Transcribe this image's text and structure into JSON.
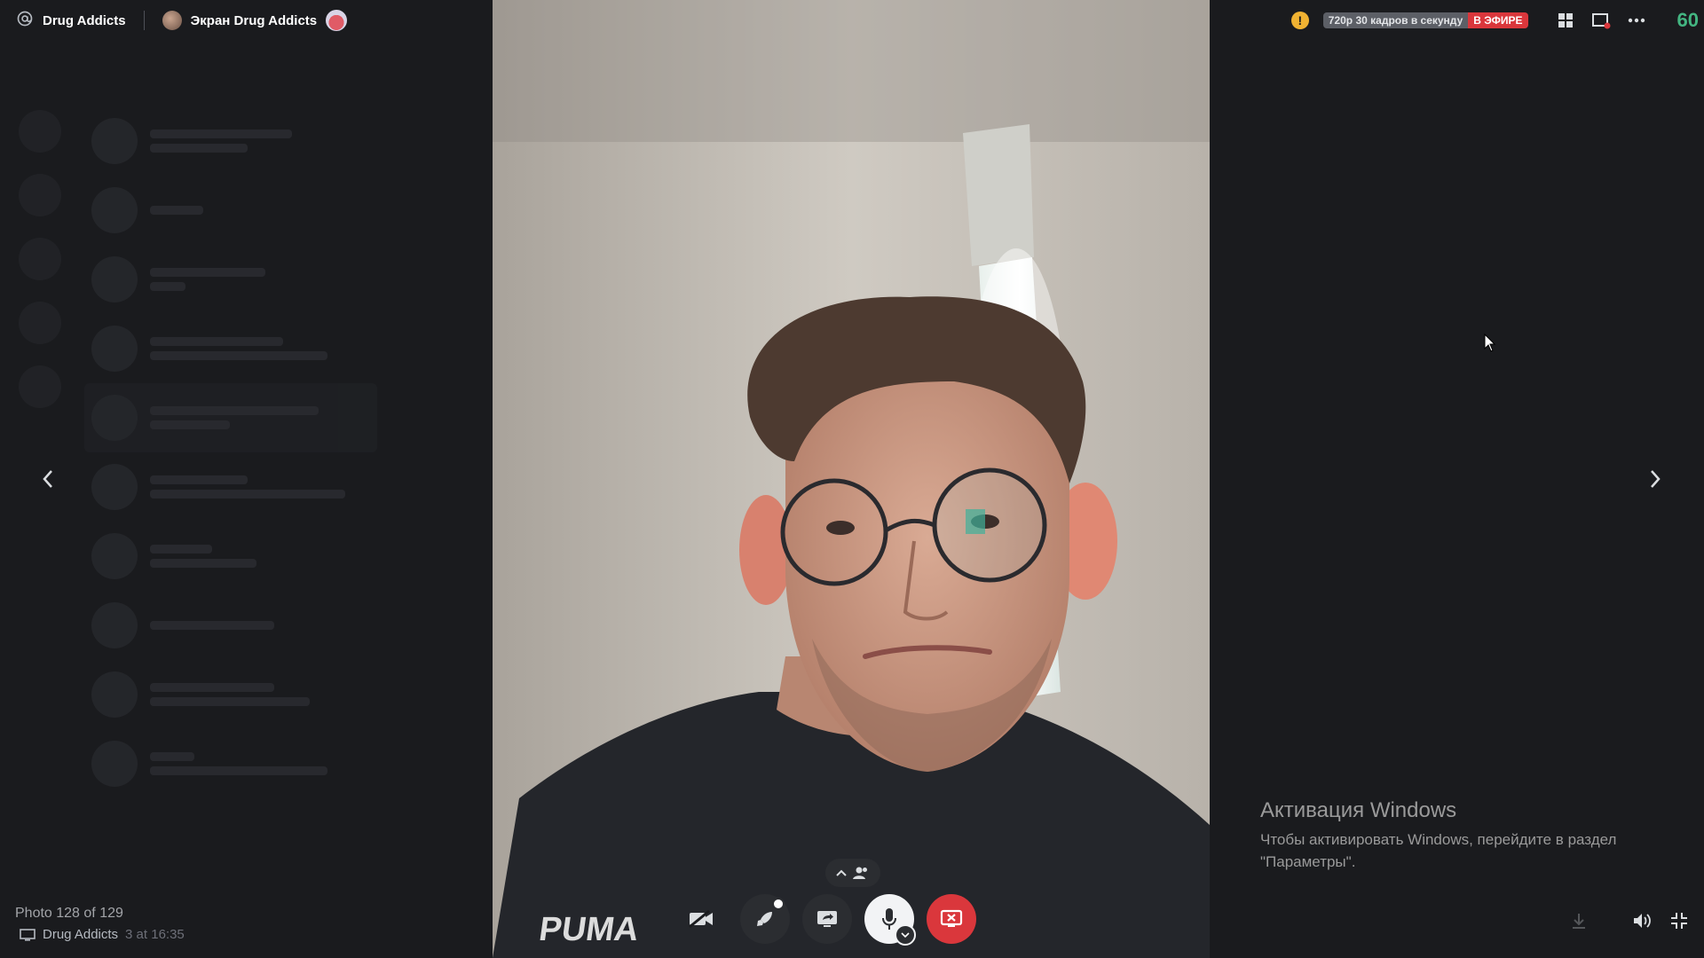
{
  "topbar": {
    "server_name": "Drug Addicts",
    "stream_title": "Экран Drug Addicts",
    "quality": "720p 30 кадров в секунду",
    "live_label": "В ЭФИРЕ",
    "fps": "60"
  },
  "viewer": {
    "counter": "Photo 128 of 129",
    "channel_chip": "Drug Addicts",
    "timestamp_fragment": "3 at 16:35"
  },
  "watermark": {
    "title": "Активация Windows",
    "body": "Чтобы активировать Windows, перейдите в раздел \"Параметры\"."
  },
  "colors": {
    "accent_live": "#da373c",
    "warning": "#f0b232",
    "fps": "#43b581",
    "background": "#1a1b1e"
  },
  "icons": {
    "server": "at-icon",
    "warning": "warning-icon",
    "grid": "grid-layout-icon",
    "popout": "popout-window-icon",
    "more": "more-icon",
    "camera": "camera-off-icon",
    "activity": "rocket-icon",
    "screen": "screen-share-icon",
    "mic": "mic-icon",
    "end": "stop-stream-icon",
    "participants": "participants-icon",
    "volume": "volume-icon",
    "exit_fullscreen": "exit-fullscreen-icon"
  }
}
